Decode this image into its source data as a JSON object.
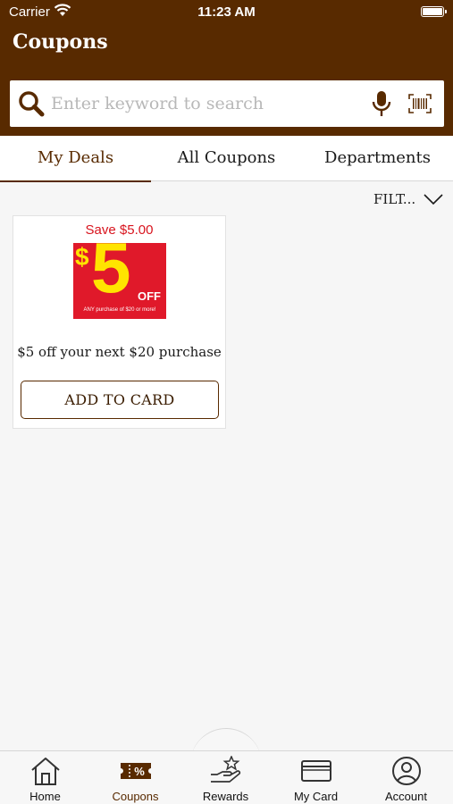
{
  "status_bar": {
    "carrier": "Carrier",
    "time": "11:23 AM"
  },
  "header": {
    "title": "Coupons"
  },
  "search": {
    "placeholder": "Enter keyword to search",
    "value": ""
  },
  "tabs": [
    {
      "label": "My Deals",
      "active": true
    },
    {
      "label": "All Coupons",
      "active": false
    },
    {
      "label": "Departments",
      "active": false
    }
  ],
  "filter": {
    "label": "FILT..."
  },
  "coupons": [
    {
      "save_text": "Save $5.00",
      "image": {
        "dollar": "$",
        "amount": "5",
        "off": "OFF",
        "fine_print": "ANY purchase of $20 or more!"
      },
      "description": "$5 off your next $20 purchase",
      "button_label": "ADD TO CARD"
    }
  ],
  "bottom_nav": [
    {
      "label": "Home",
      "icon": "home-icon",
      "active": false
    },
    {
      "label": "Coupons",
      "icon": "coupon-ticket-icon",
      "active": true
    },
    {
      "label": "Rewards",
      "icon": "rewards-hand-star-icon",
      "active": false
    },
    {
      "label": "My Card",
      "icon": "card-icon",
      "active": false
    },
    {
      "label": "Account",
      "icon": "account-icon",
      "active": false
    }
  ],
  "colors": {
    "brand_brown": "#582a00",
    "save_red": "#d8141e",
    "coupon_red": "#e0192a",
    "coupon_yellow": "#ffe400"
  }
}
